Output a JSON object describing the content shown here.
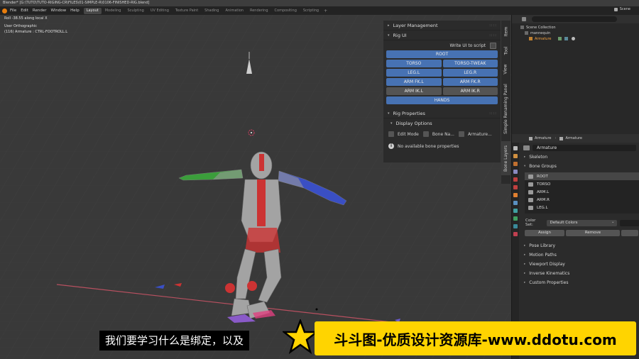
{
  "window": {
    "title": "Blender* [G:\\TUTO\\TUTO-RIGING-CR\\FILES\\01-SIMPLE-R\\0106-FINISHED-RIG.blend]"
  },
  "menubar": {
    "items": [
      "File",
      "Edit",
      "Render",
      "Window",
      "Help"
    ],
    "workspaces": [
      "Layout",
      "Modeling",
      "Sculpting",
      "UV Editing",
      "Texture Paint",
      "Shading",
      "Animation",
      "Rendering",
      "Compositing",
      "Scripting"
    ],
    "active_workspace": "Layout",
    "add_tab": "+",
    "scene_label": "Scene"
  },
  "viewport": {
    "status_line": "Roll -38.55 along local X",
    "view_label": "User Orthographic",
    "object_info": "(116) Armature : CTRL-FOOTROLL.L"
  },
  "npanel": {
    "layer_management": "Layer Management",
    "rig_ui": "Rig UI",
    "write_ui": "Write UI to script",
    "buttons": [
      {
        "label": "ROOT",
        "full": true,
        "active": true
      },
      {
        "label": "TORSO",
        "full": false,
        "active": true
      },
      {
        "label": "TORSO-TWEAK",
        "full": false,
        "active": true
      },
      {
        "label": "LEG.L",
        "full": false,
        "active": true
      },
      {
        "label": "LEG.R",
        "full": false,
        "active": true
      },
      {
        "label": "ARM FK.L",
        "full": false,
        "active": true
      },
      {
        "label": "ARM FK.R",
        "full": false,
        "active": true
      },
      {
        "label": "ARM IK.L",
        "full": false,
        "active": false
      },
      {
        "label": "ARM IK.R",
        "full": false,
        "active": false
      },
      {
        "label": "HANDS",
        "full": true,
        "active": true
      }
    ],
    "rig_properties": "Rig Properties",
    "display_options": "Display Options",
    "checks": [
      "Edit Mode",
      "Bone Na...",
      "Armature..."
    ],
    "no_props": "No available bone properties"
  },
  "side_tabs": [
    "Item",
    "Tool",
    "View",
    "Simple Renaming Panel",
    "Bone Layers"
  ],
  "outliner": {
    "rows": [
      "Scene Collection",
      "mannequin",
      "Armature"
    ]
  },
  "properties": {
    "breadcrumb": [
      "Armature",
      "Armature"
    ],
    "data_name": "Armature",
    "sections_top": [
      "Skeleton",
      "Bone Groups"
    ],
    "bone_groups": [
      "ROOT",
      "TORSO",
      "ARM.L",
      "ARM.R",
      "LEG.L"
    ],
    "color_set_label": "Color Set:",
    "color_set_value": "Default Colors",
    "assign": "Assign",
    "remove": "Remove",
    "sections_bottom": [
      "Pose Library",
      "Motion Paths",
      "Viewport Display",
      "Inverse Kinematics",
      "Custom Properties"
    ]
  },
  "overlay": {
    "subtitle": "我们要学习什么是绑定，以及",
    "banner": "斗斗图-优质设计资源库-www.ddotu.com"
  },
  "colors": {
    "accent_blue": "#4772b3",
    "banner_yellow": "#ffd400",
    "blender_orange": "#e87d0d"
  }
}
